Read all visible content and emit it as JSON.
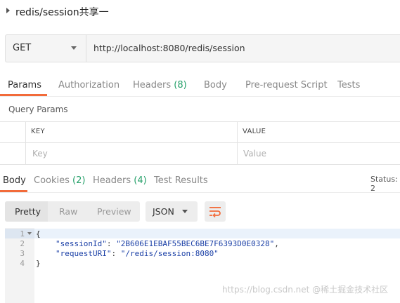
{
  "request": {
    "title": "redis/session共享一",
    "method": "GET",
    "url": "http://localhost:8080/redis/session"
  },
  "request_tabs": {
    "params": "Params",
    "authorization": "Authorization",
    "headers": "Headers",
    "headers_count": "(8)",
    "body": "Body",
    "prerequest": "Pre-request Script",
    "tests": "Tests"
  },
  "query_params": {
    "title": "Query Params",
    "key_header": "KEY",
    "value_header": "VALUE",
    "key_placeholder": "Key",
    "value_placeholder": "Value"
  },
  "response_tabs": {
    "body": "Body",
    "cookies": "Cookies",
    "cookies_count": "(2)",
    "headers": "Headers",
    "headers_count": "(4)",
    "test_results": "Test Results",
    "status": "Status: 2"
  },
  "view": {
    "pretty": "Pretty",
    "raw": "Raw",
    "preview": "Preview",
    "format": "JSON",
    "wrap_icon": "wrap-lines-icon"
  },
  "code": {
    "line_numbers": [
      "1",
      "2",
      "3",
      "4"
    ],
    "open_brace": "{",
    "close_brace": "}",
    "session_key": "\"sessionId\"",
    "session_value": "\"2B606E1EBAF55BEC6BE7F6393D0E0328\"",
    "uri_key": "\"requestURI\"",
    "uri_value": "\"/redis/session:8080\""
  },
  "watermark": "https://blog.csdn.net @稀土掘金技术社区",
  "colors": {
    "accent": "#f26b3a",
    "count_green": "#26a06a",
    "json_blue": "#1a3fa6"
  }
}
